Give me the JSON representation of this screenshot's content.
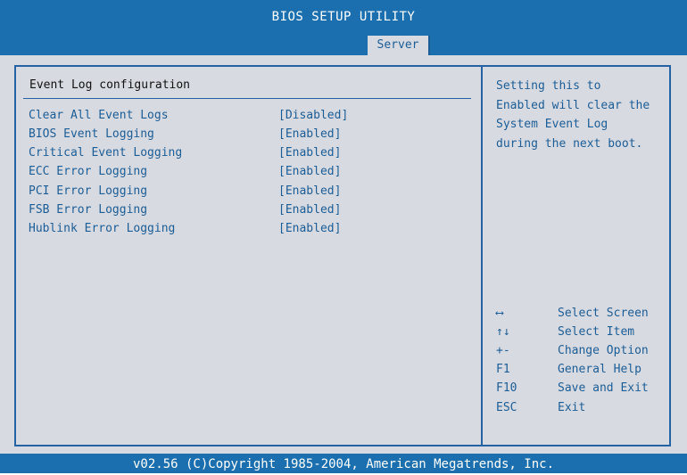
{
  "title": "BIOS SETUP UTILITY",
  "tabs": [
    {
      "label": "Server"
    }
  ],
  "section_title": "Event Log configuration",
  "options": [
    {
      "label": "Clear All Event Logs",
      "value": "[Disabled]"
    },
    {
      "label": "BIOS Event Logging",
      "value": "[Enabled]"
    },
    {
      "label": "Critical Event Logging",
      "value": "[Enabled]"
    },
    {
      "label": "ECC Error Logging",
      "value": "[Enabled]"
    },
    {
      "label": "PCI Error Logging",
      "value": "[Enabled]"
    },
    {
      "label": "FSB Error Logging",
      "value": "[Enabled]"
    },
    {
      "label": "Hublink Error Logging",
      "value": "[Enabled]"
    }
  ],
  "help_lines": [
    "Setting this to",
    "Enabled will clear the",
    "System Event Log",
    "during the next boot."
  ],
  "keys": [
    {
      "key": "⟷",
      "desc": "Select Screen"
    },
    {
      "key": "↑↓",
      "desc": "Select Item"
    },
    {
      "key": "+-",
      "desc": "Change Option"
    },
    {
      "key": "F1",
      "desc": "General Help"
    },
    {
      "key": "F10",
      "desc": "Save and Exit"
    },
    {
      "key": "ESC",
      "desc": "Exit"
    }
  ],
  "footer": "v02.56 (C)Copyright 1985-2004, American Megatrends, Inc.",
  "colors": {
    "header_blue": "#1b6fae",
    "panel_gray": "#d8dae1",
    "text_blue": "#1b5d96",
    "border_blue": "#2462a3"
  }
}
